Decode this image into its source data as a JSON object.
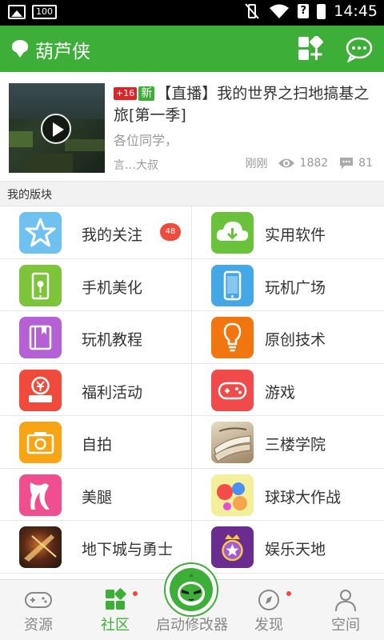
{
  "status_bar": {
    "battery_small": "100",
    "time": "14:45",
    "sim_label": "?"
  },
  "app_bar": {
    "title": "葫芦侠"
  },
  "featured_post": {
    "badge_hot": "+16",
    "badge_new": "新",
    "title": "【直播】我的世界之扫地搞基之旅[第一季]",
    "description": "各位同学，",
    "author": "言…大叔",
    "time": "刚刚",
    "views": "1882",
    "comments": "81"
  },
  "section": {
    "title": "我的版块"
  },
  "boards": [
    {
      "label": "我的关注",
      "badge": "48",
      "icon": "star-icon",
      "color": "#6fc2f0"
    },
    {
      "label": "实用软件",
      "icon": "cloud-download-icon",
      "color": "#6ac23a"
    },
    {
      "label": "手机美化",
      "icon": "phone-flower-icon",
      "color": "#7cc43a"
    },
    {
      "label": "玩机广场",
      "icon": "phone-icon",
      "color": "#45a8e6"
    },
    {
      "label": "玩机教程",
      "icon": "book-icon",
      "color": "#b560d4"
    },
    {
      "label": "原创技术",
      "icon": "lightbulb-icon",
      "color": "#f2760f"
    },
    {
      "label": "福利活动",
      "icon": "gift-money-icon",
      "color": "#f04a3c"
    },
    {
      "label": "游戏",
      "icon": "gamepad-icon",
      "color": "#f04a4a"
    },
    {
      "label": "自拍",
      "icon": "camera-icon",
      "color": "#f7a415"
    },
    {
      "label": "三楼学院",
      "icon": "books-image-icon",
      "color": "#b59e7a"
    },
    {
      "label": "美腿",
      "icon": "legs-icon",
      "color": "#ef4f8e"
    },
    {
      "label": "球球大作战",
      "icon": "balls-icon",
      "color": "#f3ef9a"
    },
    {
      "label": "地下城与勇士",
      "icon": "dnf-game-icon",
      "color": "#3a2418"
    },
    {
      "label": "娱乐天地",
      "icon": "crown-star-icon",
      "color": "#6a2c8e"
    }
  ],
  "bottom_nav": {
    "items": [
      {
        "label": "资源",
        "icon": "gamepad-outline-icon"
      },
      {
        "label": "社区",
        "icon": "grid-icon"
      },
      {
        "label": "启动修改器",
        "icon": "gourd-mascot-icon"
      },
      {
        "label": "发现",
        "icon": "compass-icon"
      },
      {
        "label": "空间",
        "icon": "person-icon"
      }
    ]
  },
  "colors": {
    "brand_green": "#3dae38",
    "badge_red": "#ee4b3e"
  }
}
